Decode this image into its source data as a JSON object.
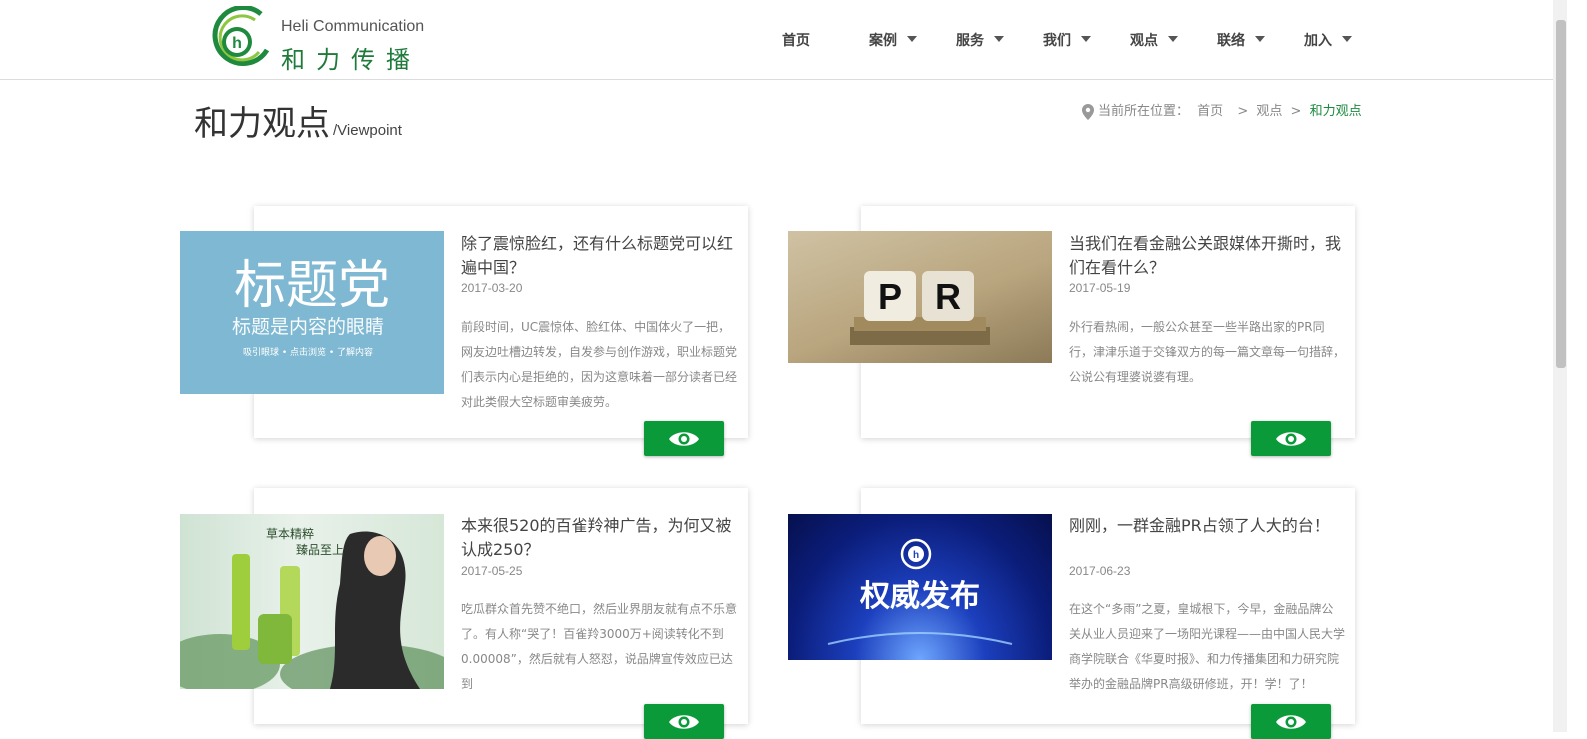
{
  "logo": {
    "en": "Heli Communication",
    "cn": "和力传播"
  },
  "nav": [
    {
      "label": "首页",
      "dropdown": false
    },
    {
      "label": "案例",
      "dropdown": true
    },
    {
      "label": "服务",
      "dropdown": true
    },
    {
      "label": "我们",
      "dropdown": true
    },
    {
      "label": "观点",
      "dropdown": true
    },
    {
      "label": "联络",
      "dropdown": true
    },
    {
      "label": "加入",
      "dropdown": true
    }
  ],
  "page": {
    "title_cn": "和力观点",
    "title_en": "/Viewpoint"
  },
  "breadcrumb": {
    "prefix": "当前所在位置：",
    "home": "首页",
    "sep": ">",
    "section": "观点",
    "current": "和力观点"
  },
  "articles": [
    {
      "title": "除了震惊脸红，还有什么标题党可以红遍中国？",
      "date": "2017-03-20",
      "desc": "前段时间，UC震惊体、脸红体、中国体火了一把，网友边吐槽边转发，自发参与创作游戏，职业标题党们表示内心是拒绝的，因为这意味着一部分读者已经对此类假大空标题审美疲劳。",
      "image_text": {
        "main": "标题党",
        "sub": "标题是内容的眼睛",
        "tags": "吸引眼球 • 点击浏览 • 了解内容"
      }
    },
    {
      "title": "当我们在看金融公关跟媒体开撕时，我们在看什么？",
      "date": "2017-05-19",
      "desc": "外行看热闹，一般公众甚至一些半路出家的PR同行，津津乐道于交锋双方的每一篇文章每一句措辞，公说公有理婆说婆有理。",
      "image_text": {
        "p": "P",
        "r": "R"
      }
    },
    {
      "title": "本来很520的百雀羚神广告，为何又被认成250？",
      "date": "2017-05-25",
      "desc": "吃瓜群众首先赞不绝口，然后业界朋友就有点不乐意了。有人称“哭了！百雀羚3000万+阅读转化不到0.00008”，然后就有人怒怼，说品牌宣传效应已达到",
      "image_text": {
        "line1": "草本精粹",
        "line2": "臻品至上"
      }
    },
    {
      "title": "刚刚，一群金融PR占领了人大的台！",
      "date": "2017-06-23",
      "desc": "在这个“多雨”之夏，皇城根下，今早，金融品牌公关从业人员迎来了一场阳光课程——由中国人民大学商学院联合《华夏时报》、和力传播集团和力研究院举办的金融品牌PR高级研修班，开！学！了！",
      "image_text": {
        "main": "权威发布"
      }
    }
  ],
  "colors": {
    "brand_green": "#0a9a3a",
    "breadcrumb_current": "#1b8a3e"
  },
  "icons": {
    "view": "eye-icon",
    "location": "pin-icon",
    "dropdown": "caret-down-icon"
  }
}
